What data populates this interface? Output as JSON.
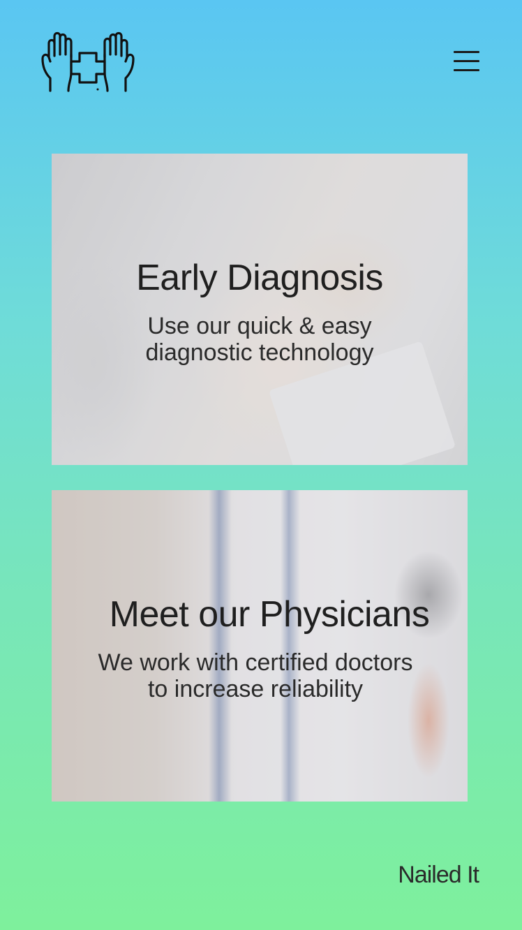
{
  "header": {
    "logo_icon": "hands-holding-medical-cross-icon",
    "menu_icon": "hamburger-menu-icon"
  },
  "cards": [
    {
      "title": "Early Diagnosis",
      "subtitle_lines": [
        "Use our quick & easy",
        "diagnostic technology"
      ],
      "background_icon": "hand-holding-hand-photo"
    },
    {
      "title": "Meet our Physicians",
      "subtitle_lines": [
        "We work with certified doctors",
        "to increase reliability"
      ],
      "background_icon": "doctor-with-stethoscope-photo"
    }
  ],
  "footer": {
    "brand": "Nailed It"
  },
  "colors": {
    "gradient_top": "#5ac6f2",
    "gradient_bottom": "#7ef09c",
    "text": "#1f1f1f"
  }
}
